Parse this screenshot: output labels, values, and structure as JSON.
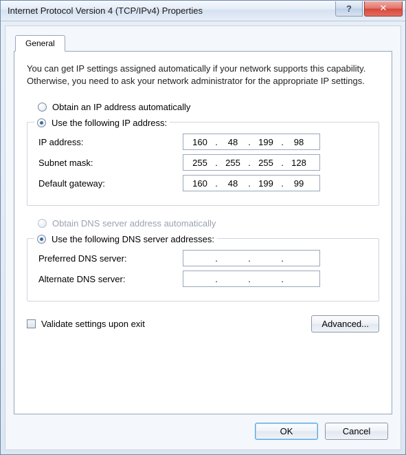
{
  "window": {
    "title": "Internet Protocol Version 4 (TCP/IPv4) Properties",
    "help_glyph": "?",
    "close_glyph": "✕"
  },
  "tab": {
    "general": "General"
  },
  "intro": "You can get IP settings assigned automatically if your network supports this capability. Otherwise, you need to ask your network administrator for the appropriate IP settings.",
  "ip": {
    "auto_label": "Obtain an IP address automatically",
    "manual_label": "Use the following IP address:",
    "address_label": "IP address:",
    "mask_label": "Subnet mask:",
    "gateway_label": "Default gateway:",
    "address": {
      "o1": "160",
      "o2": "48",
      "o3": "199",
      "o4": "98"
    },
    "mask": {
      "o1": "255",
      "o2": "255",
      "o3": "255",
      "o4": "128"
    },
    "gateway": {
      "o1": "160",
      "o2": "48",
      "o3": "199",
      "o4": "99"
    }
  },
  "dns": {
    "auto_label": "Obtain DNS server address automatically",
    "manual_label": "Use the following DNS server addresses:",
    "preferred_label": "Preferred DNS server:",
    "alternate_label": "Alternate DNS server:",
    "preferred": {
      "o1": "",
      "o2": "",
      "o3": "",
      "o4": ""
    },
    "alternate": {
      "o1": "",
      "o2": "",
      "o3": "",
      "o4": ""
    }
  },
  "validate_label": "Validate settings upon exit",
  "buttons": {
    "advanced": "Advanced...",
    "ok": "OK",
    "cancel": "Cancel"
  }
}
